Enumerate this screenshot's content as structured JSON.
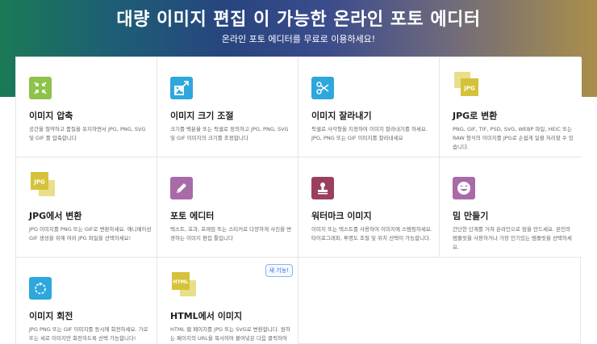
{
  "hero": {
    "title": "대량 이미지 편집 이 가능한 온라인 포토 에디터",
    "subtitle": "온라인 포토 에디터를 무료로 이용하세요!"
  },
  "colors": {
    "green": "#8fc24a",
    "blue": "#2ea7dc",
    "yellow": "#d6c23a",
    "purple": "#a86aa8",
    "maroon": "#9b3f5f"
  },
  "cards": [
    {
      "title": "이미지 압축",
      "desc": "공간을 절약하고 품질을 유지하면서 JPG, PNG, SVG 및 GIF 를 압축합니다",
      "icon": "compress-icon"
    },
    {
      "title": "이미지 크기 조절",
      "desc": "크기를 백분율 또는 픽셀로 정의하고 JPG, PNG, SVG 및 GIF 이미지의 크기를 조정합니다",
      "icon": "resize-icon"
    },
    {
      "title": "이미지 잘라내기",
      "desc": "픽셀로 사각형을 지정하여 이미지 잘라내기를 하세요. JPG, PNG 또는 GIF 이미지를 잘라내세요",
      "icon": "scissors-icon"
    },
    {
      "title": "JPG로 변환",
      "desc": "PNG, GIF, TIF, PSD, SVG, WEBP 파일, HEIC 또는 RAW 형식의 이미지를 JPG로 손쉽게 일괄 처리할 수 있습니다.",
      "icon": "jpg-file-icon",
      "icon_text": "JPG"
    },
    {
      "title": "JPG에서 변환",
      "desc": "JPG 이미지를 PNG 또는 GIF로 변환하세요. 애니메이션 GIF 생성을 위해 여러 JPG 파일을 선택하세요!",
      "icon": "jpg-file-icon",
      "icon_text": "JPG"
    },
    {
      "title": "포토 에디터",
      "desc": "텍스트, 효과, 프레임 또는 스티커로 다양하게 사진을 변경하는 이미지 편집 툴입니다",
      "icon": "pencil-icon"
    },
    {
      "title": "워터마크 이미지",
      "desc": "이미지 또는 텍스트를 사용하여 이미지에 스탬핑하세요. 타이포그래피, 투명도 조절 및 위치 선택이 가능합니다.",
      "icon": "stamp-icon"
    },
    {
      "title": "밈 만들기",
      "desc": "간단한 단계를 거쳐 온라인으로 밈을 만드세요. 본인의 템플릿을 사용하거나 가장 인기있는 템플릿을 선택하세요.",
      "icon": "smile-icon"
    },
    {
      "title": "이미지 회전",
      "desc": "JPG PNG 또는 GIF 이미지를 동시에 회전하세요. 가로 또는 세로 이미지만 회전하도록 선택 가능합니다!",
      "icon": "rotate-icon"
    },
    {
      "title": "HTML에서 이미지",
      "desc": "HTML 웹 페이지를 JPG 또는 SVG로 변환합니다. 원하는 페이지의 URL을 복사하여 붙여넣은 다음 클릭하여 이미지로 변환합니다.",
      "icon": "html-file-icon",
      "icon_text": "HTML",
      "badge": "새 기능!"
    }
  ]
}
